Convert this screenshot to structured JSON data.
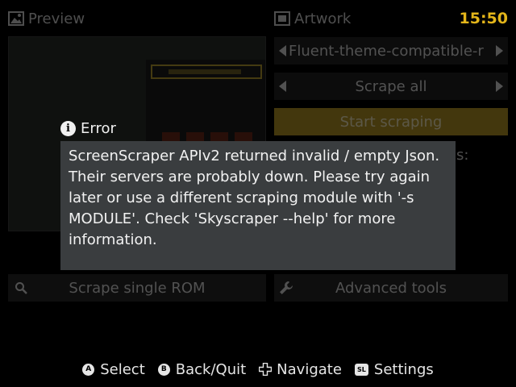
{
  "header": {
    "preview_label": "Preview",
    "artwork_label": "Artwork",
    "clock": "15:50",
    "clock_color": "#e3b51a"
  },
  "preview": {
    "icons": [
      "image-icon"
    ]
  },
  "artwork_panel": {
    "theme_value": "Fluent-theme-compatible-r",
    "scrape_mode_value": "Scrape all",
    "start_label": "Start scraping",
    "start_color": "#b39323",
    "partial_text": "s:"
  },
  "bottom_buttons": {
    "scrape_single_label": "Scrape single ROM",
    "advanced_tools_label": "Advanced tools"
  },
  "dialog": {
    "title": "Error",
    "icon": "info-icon",
    "message": "ScreenScraper APIv2 returned invalid / empty Json. Their servers are probably down. Please try again later or use a different scraping module with '-s MODULE'. Check 'Skyscraper --help' for more information."
  },
  "footer": {
    "hints": [
      {
        "badge": "A",
        "label": "Select"
      },
      {
        "badge": "B",
        "label": "Back/Quit"
      },
      {
        "badge": "dpad",
        "label": "Navigate"
      },
      {
        "badge": "SL",
        "label": "Settings"
      }
    ]
  }
}
